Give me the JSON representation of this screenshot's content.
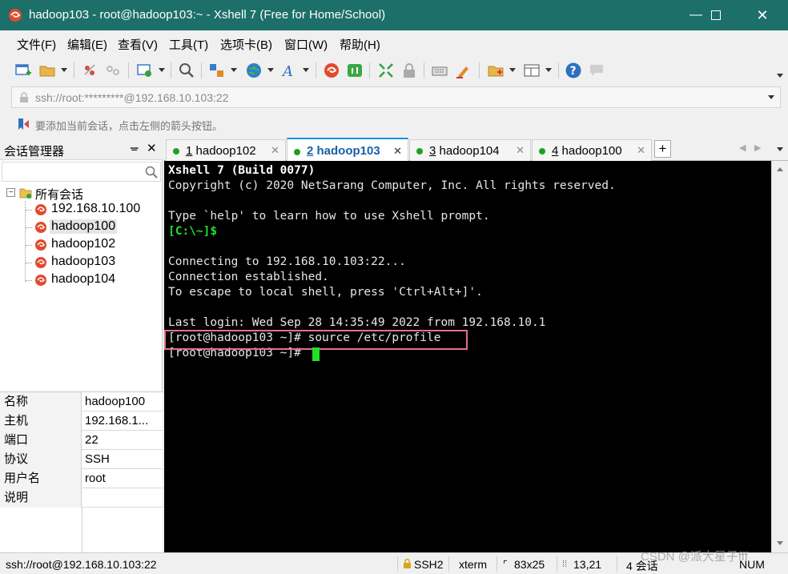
{
  "window": {
    "title": "hadoop103 - root@hadoop103:~ - Xshell 7 (Free for Home/School)"
  },
  "menu": [
    "文件(F)",
    "编辑(E)",
    "查看(V)",
    "工具(T)",
    "选项卡(B)",
    "窗口(W)",
    "帮助(H)"
  ],
  "address": {
    "value": "ssh://root:*********@192.168.10.103:22"
  },
  "hint": "要添加当前会话，点击左侧的箭头按钮。",
  "sidebar": {
    "title": "会话管理器",
    "pin": "ᚚ",
    "close": "✕",
    "root_label": "所有会话",
    "sessions": [
      "192.168.10.100",
      "hadoop100",
      "hadoop102",
      "hadoop103",
      "hadoop104"
    ],
    "selected": "hadoop100"
  },
  "properties": [
    {
      "key": "名称",
      "value": "hadoop100"
    },
    {
      "key": "主机",
      "value": "192.168.1..."
    },
    {
      "key": "端口",
      "value": "22"
    },
    {
      "key": "协议",
      "value": "SSH"
    },
    {
      "key": "用户名",
      "value": "root"
    },
    {
      "key": "说明",
      "value": ""
    }
  ],
  "tabs": [
    {
      "num": "1",
      "name": "hadoop102",
      "active": false
    },
    {
      "num": "2",
      "name": "hadoop103",
      "active": true
    },
    {
      "num": "3",
      "name": "hadoop104",
      "active": false
    },
    {
      "num": "4",
      "name": "hadoop100",
      "active": false
    }
  ],
  "terminal": {
    "lines": [
      "Xshell 7 (Build 0077)",
      "Copyright (c) 2020 NetSarang Computer, Inc. All rights reserved.",
      "",
      "Type `help' to learn how to use Xshell prompt.",
      "[C:\\~]$",
      "",
      "Connecting to 192.168.10.103:22...",
      "Connection established.",
      "To escape to local shell, press 'Ctrl+Alt+]'.",
      "",
      "Last login: Wed Sep 28 14:35:49 2022 from 192.168.10.1",
      "[root@hadoop103 ~]# source /etc/profile",
      "[root@hadoop103 ~]# "
    ]
  },
  "status": {
    "connection": "ssh://root@192.168.10.103:22",
    "protocol": "SSH2",
    "term": "xterm",
    "size": "83x25",
    "cursor": "13,21",
    "sessions": "4 会话",
    "numlock": "NUM"
  },
  "watermark": "CSDN @派大星子fff",
  "colors": {
    "titlebar": "#1d6f6a",
    "terminal_bg": "#000000",
    "prompt_green": "#22e022",
    "active_tab_accent": "#1d8fd8",
    "highlight_box": "#e4708a"
  }
}
